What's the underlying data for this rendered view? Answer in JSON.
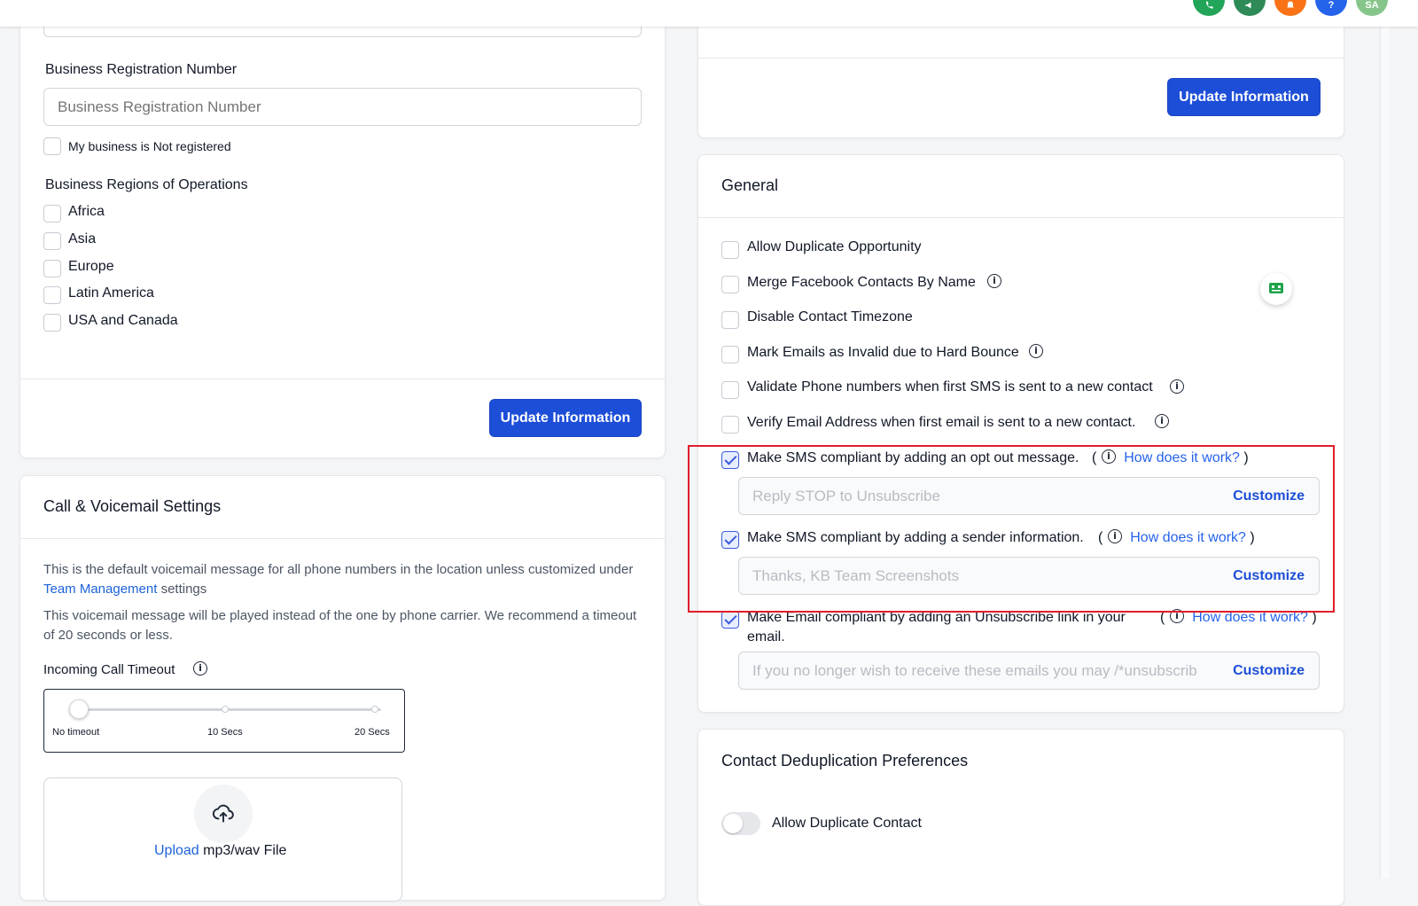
{
  "topbar": {
    "avatars": [
      {
        "icon": "phone-icon",
        "color": "#22a559"
      },
      {
        "icon": "megaphone-icon",
        "color": "#2e8b57"
      },
      {
        "icon": "bell-icon",
        "color": "#f97316"
      },
      {
        "icon": "help-icon",
        "color": "#2563eb"
      },
      {
        "initials": "SA",
        "color": "#86c58a"
      }
    ]
  },
  "business": {
    "reg_label": "Business Registration Number",
    "reg_placeholder": "Business Registration Number",
    "not_registered_label": "My business is Not registered",
    "regions_label": "Business Regions of Operations",
    "regions": [
      "Africa",
      "Asia",
      "Europe",
      "Latin America",
      "USA and Canada"
    ],
    "update_button": "Update Information"
  },
  "call": {
    "title": "Call & Voicemail Settings",
    "desc1_before": "This is the default voicemail message for all phone numbers in the location unless customized under",
    "desc1_link": "Team Management",
    "desc1_after": "settings",
    "desc2": "This voicemail message will be played instead of the one by phone carrier. We recommend a timeout of 20 seconds or less.",
    "timeout_label": "Incoming Call Timeout",
    "slider": {
      "labels": [
        "No timeout",
        "10 Secs",
        "20 Secs"
      ],
      "value": "No timeout"
    },
    "upload_link": "Upload",
    "upload_text": "mp3/wav File"
  },
  "right_top": {
    "update_button": "Update Information"
  },
  "general": {
    "title": "General",
    "options": [
      {
        "label": "Allow Duplicate Opportunity",
        "checked": false,
        "info": false
      },
      {
        "label": "Merge Facebook Contacts By Name",
        "checked": false,
        "info": true
      },
      {
        "label": "Disable Contact Timezone",
        "checked": false,
        "info": false
      },
      {
        "label": "Mark Emails as Invalid due to Hard Bounce",
        "checked": false,
        "info": true
      },
      {
        "label": "Validate Phone numbers when first SMS is sent to a new contact",
        "checked": false,
        "info": true
      },
      {
        "label": "Verify Email Address when first email is sent to a new contact.",
        "checked": false,
        "info": true
      }
    ],
    "sms_optout": {
      "label": "Make SMS compliant by adding an opt out message.",
      "checked": true,
      "how": "How does it work?",
      "placeholder": "Reply STOP to Unsubscribe",
      "customize": "Customize"
    },
    "sms_sender": {
      "label": "Make SMS compliant by adding a sender information.",
      "checked": true,
      "how": "How does it work?",
      "placeholder": "Thanks, KB Team Screenshots",
      "customize": "Customize"
    },
    "email_unsub": {
      "label_line1": "Make Email compliant by adding an Unsubscribe link in your",
      "label_line2": "email.",
      "checked": true,
      "how": "How does it work?",
      "placeholder": "If you no longer wish to receive these emails you may /*unsubscrib",
      "customize": "Customize"
    }
  },
  "dedup": {
    "title": "Contact Deduplication Preferences",
    "allow_duplicate_label": "Allow Duplicate Contact",
    "allow_duplicate_on": false
  },
  "colors": {
    "primary": "#1d4ed8",
    "highlight_border": "#e11d2b"
  }
}
